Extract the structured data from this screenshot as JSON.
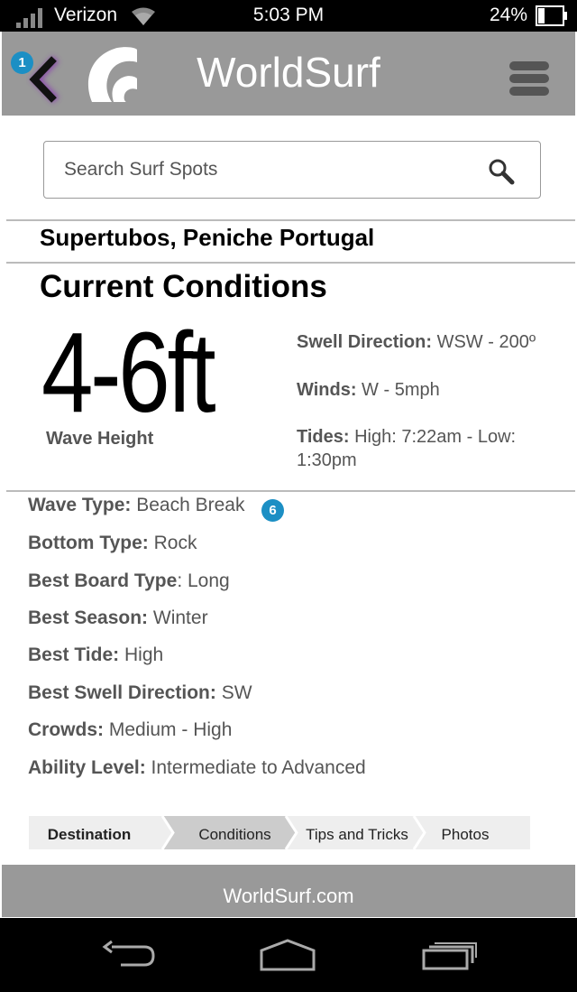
{
  "status_bar": {
    "carrier": "Verizon",
    "time": "5:03 PM",
    "battery": "24%"
  },
  "header": {
    "title": "WorldSurf",
    "back_badge": "1",
    "icons": [
      "back-chevron-icon",
      "worldsurf-logo",
      "hamburger-menu-icon"
    ]
  },
  "search": {
    "placeholder": "Search Surf Spots"
  },
  "spot": {
    "name": "Supertubos, Peniche Portugal"
  },
  "conditions": {
    "title": "Current Conditions",
    "wave_height": "4-6ft",
    "wave_height_label": "Wave Height",
    "swell_direction_label": "Swell Direction:",
    "swell_direction": "WSW - 200º",
    "winds_label": "Winds:",
    "winds": "W - 5mph",
    "tides_label": "Tides:",
    "tides": "High: 7:22am -  Low: 1:30pm"
  },
  "details": [
    {
      "label": "Wave Type:",
      "value": "Beach Break"
    },
    {
      "label": "Bottom Type:",
      "value": "Rock"
    },
    {
      "label": "Best Board Type",
      "value": ": Long"
    },
    {
      "label": "Best Season:",
      "value": "Winter"
    },
    {
      "label": "Best Tide:",
      "value": "High"
    },
    {
      "label": "Best Swell Direction:",
      "value": "SW"
    },
    {
      "label": "Crowds:",
      "value": "Medium - High"
    },
    {
      "label": "Ability Level:",
      "value": "Intermediate to Advanced"
    }
  ],
  "details_badge": "6",
  "tabs": [
    "Destination",
    "Conditions",
    "Tips and Tricks",
    "Photos"
  ],
  "active_tab": "Conditions",
  "footer": {
    "text": "WorldSurf.com"
  },
  "colors": {
    "header_bg": "#999999",
    "badge": "#1c8fc4",
    "active_tab": "#cccccc",
    "inactive_tab": "#eeeeee"
  }
}
